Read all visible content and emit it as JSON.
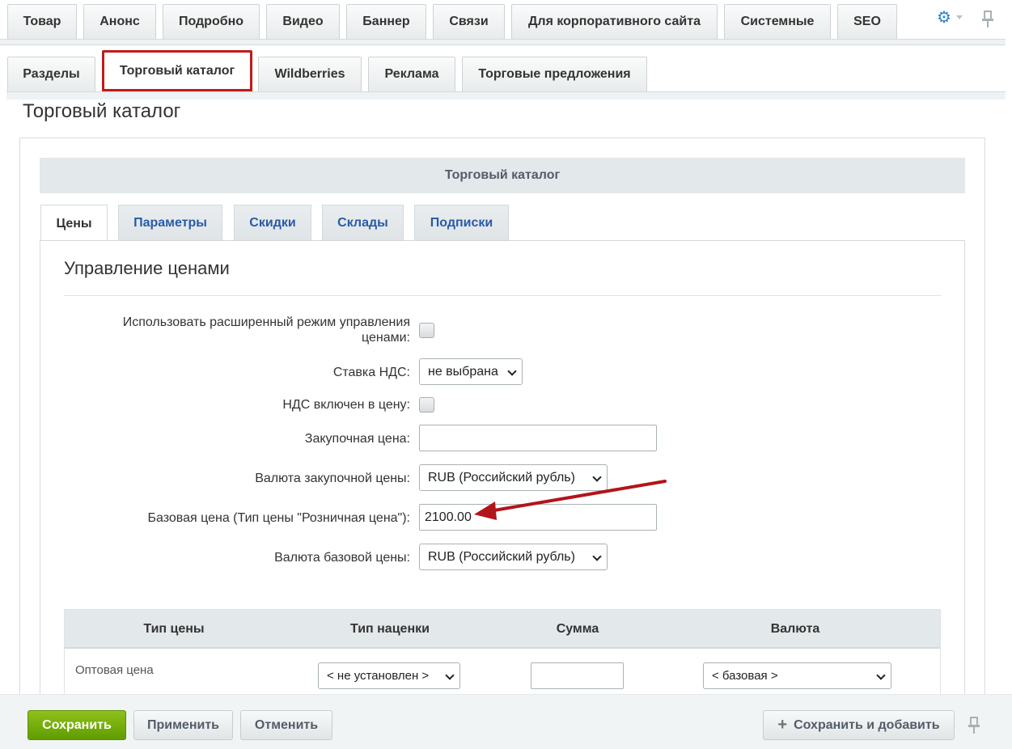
{
  "top_tabs": [
    "Товар",
    "Анонс",
    "Подробно",
    "Видео",
    "Баннер",
    "Связи",
    "Для корпоративного сайта",
    "Системные",
    "SEO"
  ],
  "sub_tabs": [
    "Разделы",
    "Торговый каталог",
    "Wildberries",
    "Реклама",
    "Торговые предложения"
  ],
  "page_title": "Торговый каталог",
  "section_title": "Торговый каталог",
  "inner_tabs": [
    "Цены",
    "Параметры",
    "Скидки",
    "Склады",
    "Подписки"
  ],
  "price_section": {
    "heading": "Управление ценами",
    "extended_mode_label_1": "Использовать расширенный режим управления",
    "extended_mode_label_2": "ценами:",
    "vat_rate_label": "Ставка НДС:",
    "vat_rate_value": "не выбрана",
    "vat_included_label": "НДС включен в цену:",
    "purchase_price_label": "Закупочная цена:",
    "purchase_price_value": "",
    "purchase_currency_label": "Валюта закупочной цены:",
    "purchase_currency_value": "RUB (Российский рубль)",
    "base_price_label": "Базовая цена (Тип цены \"Розничная цена\"):",
    "base_price_value": "2100.00",
    "base_currency_label": "Валюта базовой цены:",
    "base_currency_value": "RUB (Российский рубль)"
  },
  "price_table": {
    "headers": [
      "Тип цены",
      "Тип наценки",
      "Сумма",
      "Валюта"
    ],
    "row": {
      "label": "Оптовая цена",
      "markup": "< не установлен >",
      "sum": "",
      "currency": "< базовая >"
    }
  },
  "footer": {
    "save": "Сохранить",
    "apply": "Применить",
    "cancel": "Отменить",
    "save_add": "Сохранить и добавить"
  },
  "colors": {
    "accent_red": "#c11a1a",
    "primary_green": "#6fa80a",
    "link_blue": "#2a5aa7"
  }
}
